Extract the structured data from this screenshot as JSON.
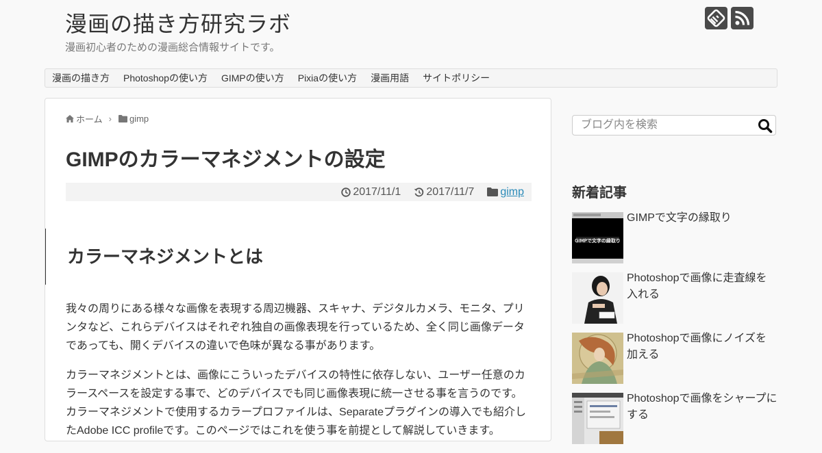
{
  "site": {
    "title": "漫画の描き方研究ラボ",
    "description": "漫画初心者のための漫画総合情報サイトです。"
  },
  "sns_icons": [
    "feedly-icon",
    "rss-icon"
  ],
  "nav": {
    "items": [
      {
        "label": "漫画の描き方"
      },
      {
        "label": "Photoshopの使い方"
      },
      {
        "label": "GIMPの使い方"
      },
      {
        "label": "Pixiaの使い方"
      },
      {
        "label": "漫画用語"
      },
      {
        "label": "サイトポリシー"
      }
    ]
  },
  "breadcrumb": {
    "home": "ホーム",
    "category": "gimp"
  },
  "article": {
    "title": "GIMPのカラーマネジメントの設定",
    "published": "2017/11/1",
    "updated": "2017/11/7",
    "category": "gimp",
    "heading": "カラーマネジメントとは",
    "paragraphs": [
      "我々の周りにある様々な画像を表現する周辺機器、スキャナ、デジタルカメラ、モニタ、プリンタなど、これらデバイスはそれぞれ独自の画像表現を行っているため、全く同じ画像データであっても、開くデバイスの違いで色味が異なる事があります。",
      "カラーマネジメントとは、画像にこういったデバイスの特性に依存しない、ユーザー任意のカラースペースを設定する事で、どのデバイスでも同じ画像表現に統一させる事を言うのです。カラーマネジメントで使用するカラープロファイルは、Separateプラグインの導入でも紹介したAdobe ICC profileです。このページではこれを使う事を前提として解説していきます。"
    ]
  },
  "search": {
    "placeholder": "ブログ内を検索"
  },
  "sidebar": {
    "recent_title": "新着記事",
    "recent_posts": [
      {
        "title": "GIMPで文字の縁取り",
        "thumb_text": "GIMPで文字の縁取り"
      },
      {
        "title": "Photoshopで画像に走査線を入れる"
      },
      {
        "title": "Photoshopで画像にノイズを加える"
      },
      {
        "title": "Photoshopで画像をシャープにする"
      }
    ]
  },
  "colors": {
    "accent_link": "#2a8ab8",
    "icon_dark": "#4a4a4a",
    "meta_bg": "#f3f3f3"
  }
}
